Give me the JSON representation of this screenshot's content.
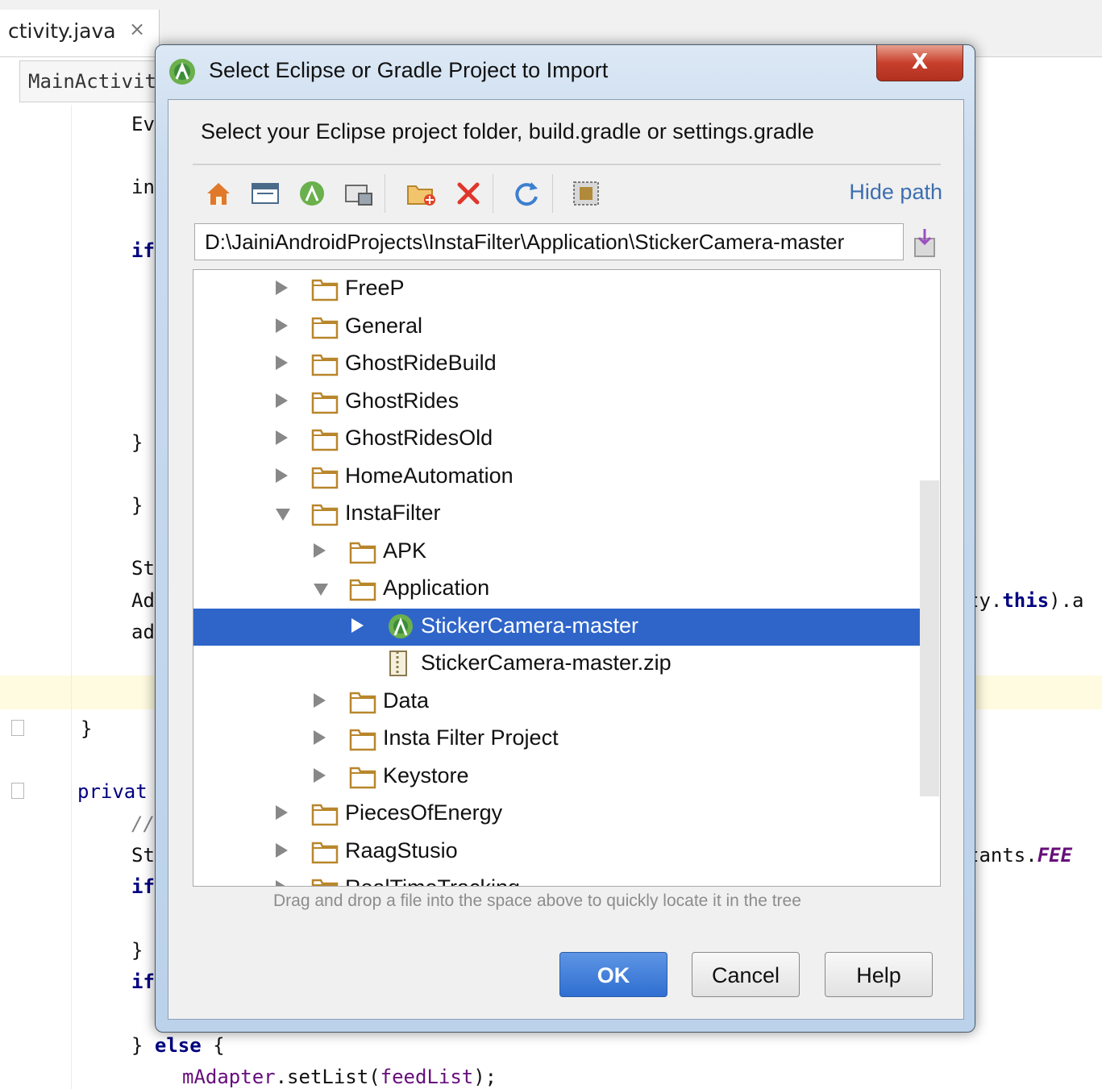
{
  "ide": {
    "tab_label": "ctivity.java",
    "tab_close": "×",
    "crumb_label": "MainActivit",
    "code": {
      "l1": "Ev",
      "l2": "in",
      "l3": "if",
      "l4": "}",
      "l5": "}",
      "l6": "St",
      "l7": "Ad",
      "l8": "ad",
      "l9": "}",
      "l10": "privat",
      "l11": "//",
      "l12": "St",
      "l13": "if",
      "l14": "}",
      "l15": "if",
      "l16_close": "}",
      "l16_else": "else",
      "l16_brace": "{",
      "l17_obj": "mAdapter",
      "l17_rest": ".setList(",
      "l17_arg": "feedList",
      "l17_end": ");",
      "r1_a": "ty.",
      "r1_kw": "this",
      "r1_b": ").a",
      "r2_a": "tants.",
      "r2_fld": "FEE"
    }
  },
  "dialog": {
    "title": "Select Eclipse or Gradle Project to Import",
    "close_label": "X",
    "subtitle": "Select your Eclipse project folder, build.gradle or settings.gradle",
    "toolbar": {
      "home": "home-icon",
      "desktop": "desktop-icon",
      "project": "project-icon",
      "module": "module-icon",
      "new_folder": "new-folder-icon",
      "delete": "delete-icon",
      "refresh": "refresh-icon",
      "show_hidden": "show-hidden-icon"
    },
    "hide_path_label": "Hide path",
    "path_value": "D:\\JainiAndroidProjects\\InstaFilter\\Application\\StickerCamera-master",
    "tree": [
      {
        "label": "FreeP",
        "state": "collapsed",
        "type": "folder",
        "depth": 0
      },
      {
        "label": "General",
        "state": "collapsed",
        "type": "folder",
        "depth": 0
      },
      {
        "label": "GhostRideBuild",
        "state": "collapsed",
        "type": "folder",
        "depth": 0
      },
      {
        "label": "GhostRides",
        "state": "collapsed",
        "type": "folder",
        "depth": 0
      },
      {
        "label": "GhostRidesOld",
        "state": "collapsed",
        "type": "folder",
        "depth": 0
      },
      {
        "label": "HomeAutomation",
        "state": "collapsed",
        "type": "folder",
        "depth": 0
      },
      {
        "label": "InstaFilter",
        "state": "expanded",
        "type": "folder",
        "depth": 0
      },
      {
        "label": "APK",
        "state": "collapsed",
        "type": "folder",
        "depth": 1
      },
      {
        "label": "Application",
        "state": "expanded",
        "type": "folder",
        "depth": 1
      },
      {
        "label": "StickerCamera-master",
        "state": "collapsed",
        "type": "android",
        "depth": 2,
        "selected": true
      },
      {
        "label": "StickerCamera-master.zip",
        "state": "none",
        "type": "zip",
        "depth": 2
      },
      {
        "label": "Data",
        "state": "collapsed",
        "type": "folder",
        "depth": 1
      },
      {
        "label": "Insta Filter Project",
        "state": "collapsed",
        "type": "folder",
        "depth": 1
      },
      {
        "label": "Keystore",
        "state": "collapsed",
        "type": "folder",
        "depth": 1
      },
      {
        "label": "PiecesOfEnergy",
        "state": "collapsed",
        "type": "folder",
        "depth": 0
      },
      {
        "label": "RaagStusio",
        "state": "collapsed",
        "type": "folder",
        "depth": 0
      },
      {
        "label": "RealTimeTracking",
        "state": "collapsed",
        "type": "folder",
        "depth": 0
      }
    ],
    "hint": "Drag and drop a file into the space above to quickly locate it in the tree",
    "buttons": {
      "ok": "OK",
      "cancel": "Cancel",
      "help": "Help"
    }
  },
  "colors": {
    "selection": "#2f65c9",
    "link": "#3d6fb0",
    "primary_button": "#2f6fd1",
    "close_button": "#c8402c",
    "folder": "#b8862b"
  }
}
